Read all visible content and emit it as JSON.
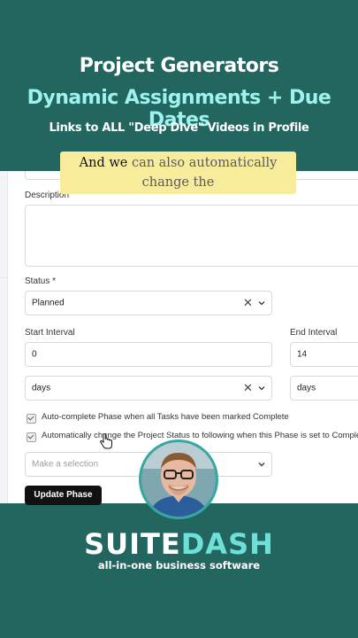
{
  "header": {
    "title": "Project Generators",
    "subtitle": "Dynamic Assignments + Due Dates",
    "note": "Links to ALL \"Deep Dive\" Videos in Profile"
  },
  "caption": {
    "highlight": "And we",
    "text": " can also automatically change the"
  },
  "form": {
    "description_label": "Description",
    "status_label": "Status *",
    "status_value": "Planned",
    "start_interval_label": "Start Interval",
    "start_interval_value": "0",
    "end_interval_label": "End Interval",
    "end_interval_value": "14",
    "start_unit_value": "days",
    "end_unit_value": "days",
    "auto_complete_label": "Auto-complete Phase when all Tasks have been marked Complete",
    "auto_status_label": "Automatically change the Project Status to following when this Phase is set to Complete",
    "selection_placeholder": "Make a selection",
    "update_button": "Update Phase"
  },
  "icons": {
    "clear": "close-icon",
    "dropdown": "chevron-down-icon",
    "cursor": "hand-cursor-icon"
  },
  "footer": {
    "brand_left": "SUITE",
    "brand_right": "DASH",
    "tagline": "all-in-one business software"
  },
  "colors": {
    "teal_bg": "#236660",
    "accent_cyan": "#9ff3ee",
    "caption_bg": "#f7ec9c"
  }
}
